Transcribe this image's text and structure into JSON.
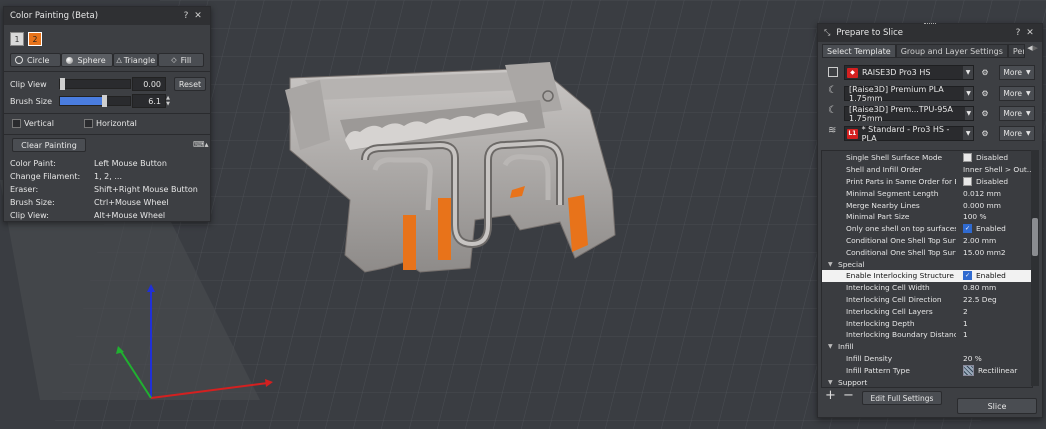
{
  "color_panel": {
    "title": "Color Painting (Beta)",
    "help": "?",
    "close": "✕",
    "filament_1": "1",
    "filament_2": "2",
    "modes": [
      "Circle",
      "Sphere",
      "Triangle",
      "Fill"
    ],
    "clip_view_label": "Clip View",
    "clip_view_value": "0.00",
    "clip_view_level": 0.0,
    "reset_label": "Reset",
    "brush_size_label": "Brush Size",
    "brush_size_value": "6.1",
    "brush_size_level": 0.61,
    "vertical_label": "Vertical",
    "horizontal_label": "Horizontal",
    "clear_label": "Clear Painting",
    "shortcuts": [
      {
        "k": "Color Paint:",
        "v": "Left Mouse Button"
      },
      {
        "k": "Change Filament:",
        "v": "1, 2, ..."
      },
      {
        "k": "Eraser:",
        "v": "Shift+Right Mouse Button"
      },
      {
        "k": "Brush Size:",
        "v": "Ctrl+Mouse Wheel"
      },
      {
        "k": "Clip View:",
        "v": "Alt+Mouse Wheel"
      }
    ]
  },
  "slice_panel": {
    "title": "Prepare to Slice",
    "help": "?",
    "close": "✕",
    "tabs": [
      "Select Template",
      "Group and Layer Settings",
      "Per-Model"
    ],
    "printer": "RAISE3D Pro3 HS",
    "filament_1": "[Raise3D] Premium PLA 1.75mm",
    "filament_2": "[Raise3D] Prem...TPU-95A 1.75mm",
    "profile": "* Standard - Pro3 HS - PLA",
    "more_label": "More",
    "settings": [
      {
        "type": "row",
        "k": "Single Shell Surface Mode",
        "v": "Disabled",
        "chk": "off"
      },
      {
        "type": "row",
        "k": "Shell and Infill Order",
        "v": "Inner Shell > Out..."
      },
      {
        "type": "row",
        "k": "Print Parts in Same Order for E...",
        "v": "Disabled",
        "chk": "off"
      },
      {
        "type": "row",
        "k": "Minimal Segment Length",
        "v": "0.012 mm"
      },
      {
        "type": "row",
        "k": "Merge Nearby Lines",
        "v": "0.000 mm"
      },
      {
        "type": "row",
        "k": "Minimal Part Size",
        "v": "100 %"
      },
      {
        "type": "row",
        "k": "Only one shell on top surfaces",
        "v": "Enabled",
        "chk": "on"
      },
      {
        "type": "row",
        "k": "Conditional One Shell Top Surf...",
        "v": "2.00 mm"
      },
      {
        "type": "row",
        "k": "Conditional One Shell Top Surf...",
        "v": "15.00 mm2"
      },
      {
        "type": "cat",
        "k": "Special"
      },
      {
        "type": "row",
        "k": "Enable Interlocking Structure",
        "v": "Enabled",
        "chk": "on",
        "hl": true
      },
      {
        "type": "row",
        "k": "Interlocking Cell Width",
        "v": "0.80 mm"
      },
      {
        "type": "row",
        "k": "Interlocking Cell Direction",
        "v": "22.5 Deg"
      },
      {
        "type": "row",
        "k": "Interlocking Cell Layers",
        "v": "2"
      },
      {
        "type": "row",
        "k": "Interlocking Depth",
        "v": "1"
      },
      {
        "type": "row",
        "k": "Interlocking Boundary Distance",
        "v": "1"
      },
      {
        "type": "cat",
        "k": "Infill"
      },
      {
        "type": "row",
        "k": "Infill Density",
        "v": "20 %"
      },
      {
        "type": "row",
        "k": "Infill Pattern Type",
        "v": "Rectilinear",
        "pattern": true
      },
      {
        "type": "cat",
        "k": "Support"
      }
    ],
    "add_label": "+",
    "remove_label": "−",
    "edit_label": "Edit Full Settings",
    "slice_label": "Slice"
  },
  "colors": {
    "accent_orange": "#e8731a",
    "enabled_blue": "#2f6ad0",
    "axis_x": "#d42020",
    "axis_y": "#20b030",
    "axis_z": "#2030d8"
  }
}
